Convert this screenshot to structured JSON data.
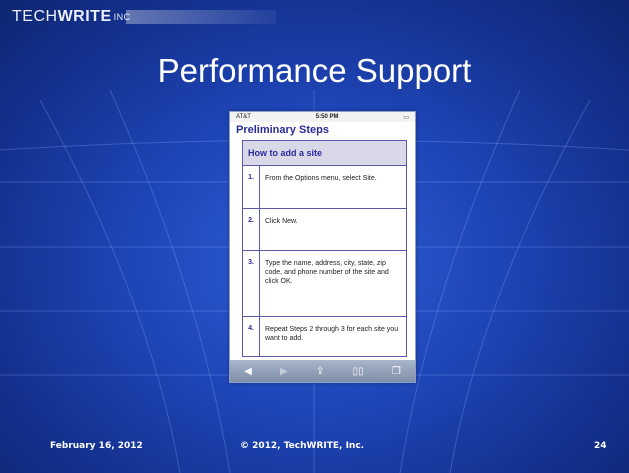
{
  "logo": {
    "tech": "TECH",
    "write": "WRITE",
    "inc": "INC"
  },
  "slide": {
    "title": "Performance Support"
  },
  "phone": {
    "carrier": "AT&T",
    "time": "5:50 PM",
    "page_title": "Preliminary Steps",
    "table_header": "How to add a site",
    "steps": [
      {
        "num": "1.",
        "text": "From the Options menu, select Site."
      },
      {
        "num": "2.",
        "text": "Click New."
      },
      {
        "num": "3.",
        "text": "Type the name, address, city, state, zip code, and phone number of the site and click OK."
      },
      {
        "num": "4.",
        "text": "Repeat Steps 2 through 3 for each site you want to add."
      }
    ],
    "toolbar": [
      "back-icon",
      "forward-icon",
      "share-icon",
      "bookmarks-icon",
      "tabs-icon"
    ]
  },
  "footer": {
    "date": "February 16, 2012",
    "copyright": "© 2012, TechWRITE, Inc.",
    "page": "24"
  }
}
